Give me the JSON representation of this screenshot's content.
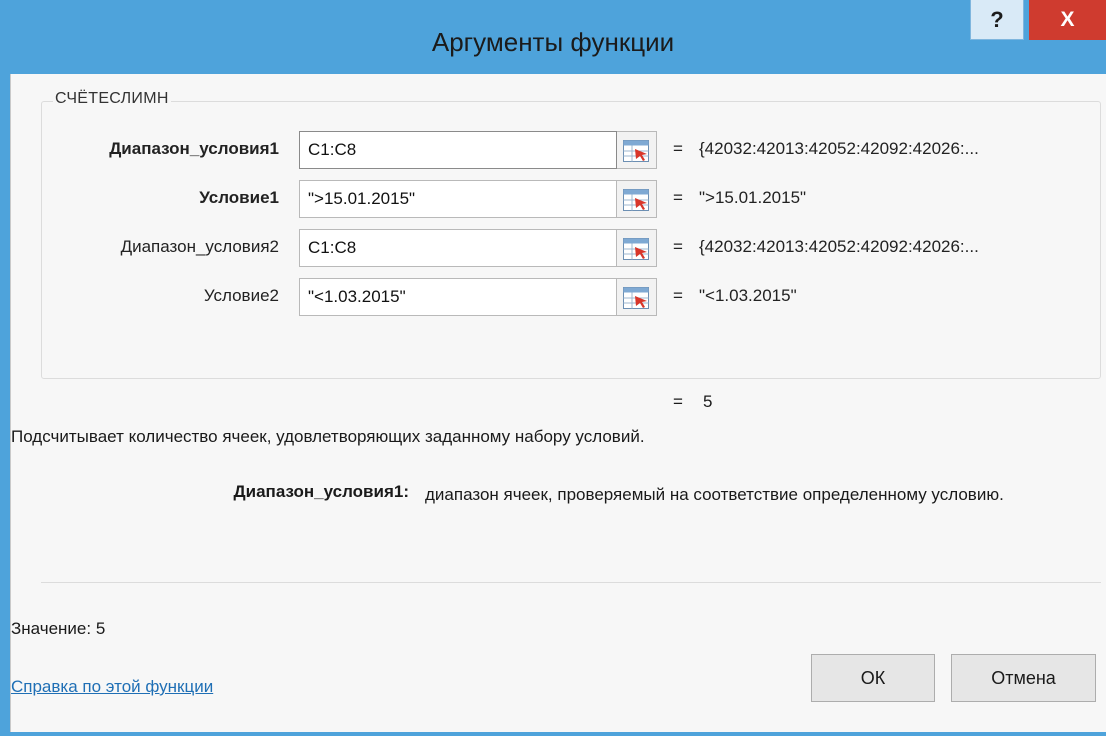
{
  "window": {
    "title": "Аргументы функции",
    "help_label": "?",
    "close_label": "X"
  },
  "function_name": "СЧЁТЕСЛИМН",
  "arguments": [
    {
      "label": "Диапазон_условия1",
      "value": "C1:C8",
      "result": "{42032:42013:42052:42092:42026:..."
    },
    {
      "label": "Условие1",
      "value": "\">15.01.2015\"",
      "result": "\">15.01.2015\""
    },
    {
      "label": "Диапазон_условия2",
      "value": "C1:C8",
      "result": "{42032:42013:42052:42092:42026:..."
    },
    {
      "label": "Условие2",
      "value": "\"<1.03.2015\"",
      "result": "\"<1.03.2015\""
    }
  ],
  "equals_sign": "=",
  "overall_result": "5",
  "description": "Подсчитывает количество ячеек, удовлетворяющих заданному набору условий.",
  "argument_help": {
    "name": "Диапазон_условия1:",
    "text": "диапазон ячеек, проверяемый на соответствие определенному условию."
  },
  "value_label": "Значение:  5",
  "help_link": "Справка по этой функции",
  "buttons": {
    "ok": "ОК",
    "cancel": "Отмена"
  },
  "colors": {
    "titlebar": "#4ea3db",
    "close_button": "#cf3b2f",
    "link": "#1f6fb5"
  },
  "icons": [
    "help-icon",
    "close-icon",
    "range-select-icon"
  ]
}
